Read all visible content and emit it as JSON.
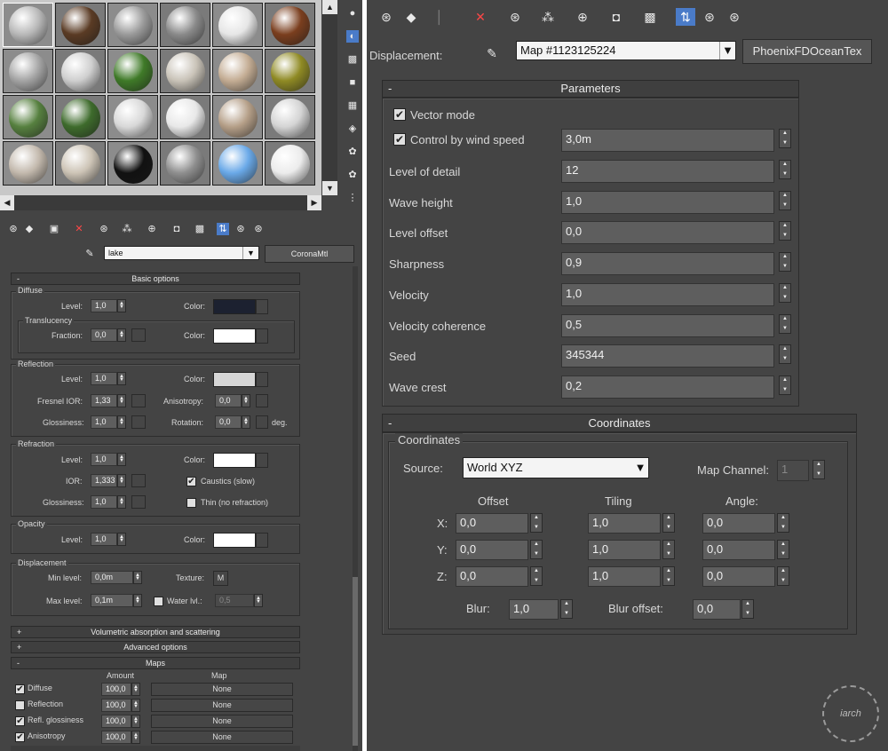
{
  "left": {
    "slots": [
      {
        "color": "#b8b8b8",
        "label": ""
      },
      {
        "color": "#5a3b24",
        "label": ""
      },
      {
        "color": "#9a9a9a",
        "label": ""
      },
      {
        "color": "#8a8a8a",
        "label": ""
      },
      {
        "color": "#e6e6e6",
        "label": ""
      },
      {
        "color": "#7a3e1e",
        "label": ""
      },
      {
        "color": "#a4a4a4",
        "label": ""
      },
      {
        "color": "#cfcfcf",
        "label": ""
      },
      {
        "color": "#3f7a28",
        "label": ""
      },
      {
        "color": "#c9c3b8",
        "label": ""
      },
      {
        "color": "#c4ad94",
        "label": ""
      },
      {
        "color": "#8f8a24",
        "label": ""
      },
      {
        "color": "#56803f",
        "label": ""
      },
      {
        "color": "#3e6b2c",
        "label": ""
      },
      {
        "color": "#d8d8d8",
        "label": ""
      },
      {
        "color": "#e8e8e8",
        "label": ""
      },
      {
        "color": "#b59f88",
        "label": ""
      },
      {
        "color": "#d4d4d4",
        "label": ""
      },
      {
        "color": "#c3b9ad",
        "label": ""
      },
      {
        "color": "#cdc4b6",
        "label": ""
      },
      {
        "color": "#111111",
        "label": ""
      },
      {
        "color": "#8f8f8f",
        "label": ""
      },
      {
        "color": "#6aa9e8",
        "label": ""
      },
      {
        "color": "#ececec",
        "label": ""
      }
    ],
    "material_name": "lake",
    "material_type": "CoronaMtl",
    "rollouts": {
      "basic": "Basic options",
      "volumetric": "Volumetric absorption and scattering",
      "advanced": "Advanced options",
      "maps": "Maps"
    },
    "diffuse": {
      "title": "Diffuse",
      "level_label": "Level:",
      "level": "1,0",
      "color_label": "Color:",
      "color": "#1c2130",
      "translucency_title": "Translucency",
      "fraction_label": "Fraction:",
      "fraction": "0,0",
      "t_color_label": "Color:",
      "t_color": "#ffffff"
    },
    "reflection": {
      "title": "Reflection",
      "level_label": "Level:",
      "level": "1,0",
      "color_label": "Color:",
      "color": "#d6d6d6",
      "fresnel_label": "Fresnel IOR:",
      "fresnel": "1,33",
      "aniso_label": "Anisotropy:",
      "aniso": "0,0",
      "gloss_label": "Glossiness:",
      "gloss": "1,0",
      "rotation_label": "Rotation:",
      "rotation": "0,0",
      "deg": "deg."
    },
    "refraction": {
      "title": "Refraction",
      "level_label": "Level:",
      "level": "1,0",
      "color_label": "Color:",
      "color": "#ffffff",
      "ior_label": "IOR:",
      "ior": "1,333",
      "caustics": "Caustics (slow)",
      "gloss_label": "Glossiness:",
      "gloss": "1,0",
      "thin": "Thin (no refraction)"
    },
    "opacity": {
      "title": "Opacity",
      "level_label": "Level:",
      "level": "1,0",
      "color_label": "Color:",
      "color": "#ffffff"
    },
    "displacement": {
      "title": "Displacement",
      "min_label": "Min level:",
      "min": "0,0m",
      "texture_label": "Texture:",
      "texture_btn": "M",
      "max_label": "Max level:",
      "max": "0,1m",
      "water_label": "Water lvl.:",
      "water": "0,5"
    },
    "maps": {
      "amount_header": "Amount",
      "map_header": "Map",
      "rows": [
        {
          "name": "Diffuse",
          "checked": "✔",
          "amount": "100,0",
          "map": "None"
        },
        {
          "name": "Reflection",
          "checked": "",
          "amount": "100,0",
          "map": "None"
        },
        {
          "name": "Refl. glossiness",
          "checked": "✔",
          "amount": "100,0",
          "map": "None"
        },
        {
          "name": "Anisotropy",
          "checked": "✔",
          "amount": "100,0",
          "map": "None"
        }
      ]
    }
  },
  "right": {
    "displacement_label": "Displacement:",
    "map_name": "Map #1123125224",
    "map_type": "PhoenixFDOceanTex",
    "parameters_title": "Parameters",
    "vector_mode": "Vector mode",
    "control_by_wind": "Control by wind speed",
    "wind_speed": "3,0m",
    "params": [
      {
        "label": "Level of detail",
        "value": "12"
      },
      {
        "label": "Wave height",
        "value": "1,0"
      },
      {
        "label": "Level offset",
        "value": "0,0"
      },
      {
        "label": "Sharpness",
        "value": "0,9"
      },
      {
        "label": "Velocity",
        "value": "1,0"
      },
      {
        "label": "Velocity coherence",
        "value": "0,5"
      },
      {
        "label": "Seed",
        "value": "345344"
      },
      {
        "label": "Wave crest",
        "value": "0,2"
      }
    ],
    "coordinates_title": "Coordinates",
    "coordinates_group": "Coordinates",
    "source_label": "Source:",
    "source_value": "World XYZ",
    "map_channel_label": "Map Channel:",
    "map_channel": "1",
    "offset_header": "Offset",
    "tiling_header": "Tiling",
    "angle_header": "Angle:",
    "axes": [
      {
        "axis": "X:",
        "offset": "0,0",
        "tiling": "1,0",
        "angle": "0,0"
      },
      {
        "axis": "Y:",
        "offset": "0,0",
        "tiling": "1,0",
        "angle": "0,0"
      },
      {
        "axis": "Z:",
        "offset": "0,0",
        "tiling": "1,0",
        "angle": "0,0"
      }
    ],
    "blur_label": "Blur:",
    "blur": "1,0",
    "blur_offset_label": "Blur offset:",
    "blur_offset": "0,0"
  },
  "watermark": "iarch"
}
